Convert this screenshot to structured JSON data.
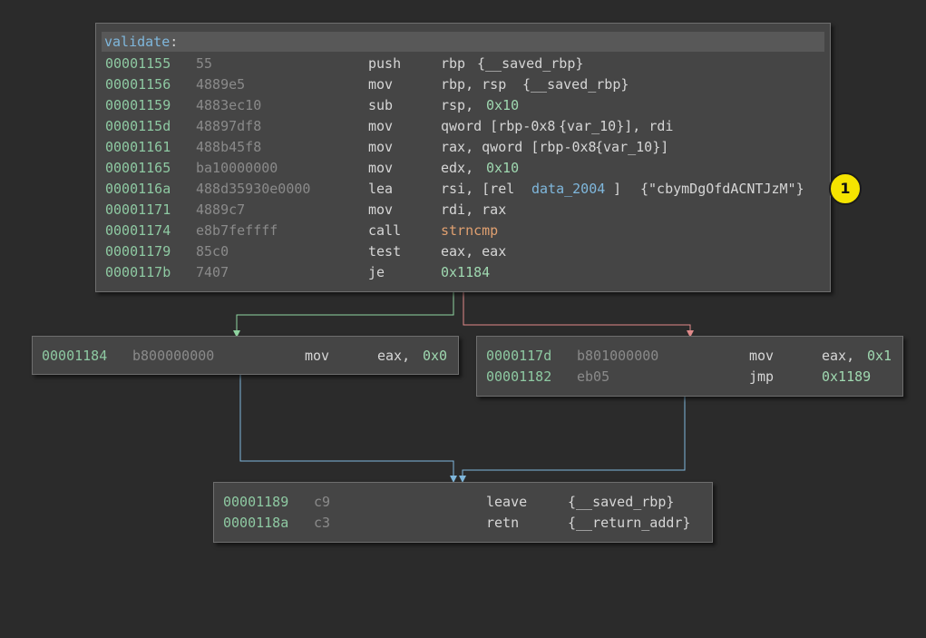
{
  "colors": {
    "background": "#2b2b2b",
    "block_bg": "#454545",
    "address": "#8ec9a2",
    "bytes": "#8a8a8a",
    "symbol": "#7fb7dc",
    "call_target": "#e0a070",
    "edge_true": "#8fd4a0",
    "edge_false": "#e08a8a",
    "edge_unconditional": "#7fb7dc",
    "badge": "#f5e400"
  },
  "entry_block": {
    "function_name": "validate",
    "colon": ":",
    "rows": [
      {
        "addr": "00001155",
        "bytes": "55",
        "mnem": "push",
        "op1": "rbp",
        "op2": "{__saved_rbp}"
      },
      {
        "addr": "00001156",
        "bytes": "4889e5",
        "mnem": "mov",
        "op1": "rbp, rsp",
        "op2": "{__saved_rbp}"
      },
      {
        "addr": "00001159",
        "bytes": "4883ec10",
        "mnem": "sub",
        "op1": "rsp,",
        "op2": "0x10"
      },
      {
        "addr": "0000115d",
        "bytes": "48897df8",
        "mnem": "mov",
        "op1": "qword [rbp-0x8",
        "op2": "{var_10}], rdi"
      },
      {
        "addr": "00001161",
        "bytes": "488b45f8",
        "mnem": "mov",
        "op1": "rax, qword [rbp-0x8",
        "op2": "{var_10}]"
      },
      {
        "addr": "00001165",
        "bytes": "ba10000000",
        "mnem": "mov",
        "op1": "edx,",
        "op2": "0x10"
      },
      {
        "addr": "0000116a",
        "bytes": "488d35930e0000",
        "mnem": "lea",
        "op1": "rsi, [rel",
        "op2": "data_2004",
        "op3": "]",
        "op4": "{\"cbymDgOfdACNTJzM\"}"
      },
      {
        "addr": "00001171",
        "bytes": "4889c7",
        "mnem": "mov",
        "op1": "rdi, rax"
      },
      {
        "addr": "00001174",
        "bytes": "e8b7feffff",
        "mnem": "call",
        "op1": "strncmp"
      },
      {
        "addr": "00001179",
        "bytes": "85c0",
        "mnem": "test",
        "op1": "eax, eax"
      },
      {
        "addr": "0000117b",
        "bytes": "7407",
        "mnem": "je",
        "op1": "0x1184"
      }
    ]
  },
  "true_block": {
    "rows": [
      {
        "addr": "00001184",
        "bytes": "b800000000",
        "mnem": "mov",
        "op1": "eax,",
        "op2": "0x0"
      }
    ]
  },
  "false_block": {
    "rows": [
      {
        "addr": "0000117d",
        "bytes": "b801000000",
        "mnem": "mov",
        "op1": "eax,",
        "op2": "0x1"
      },
      {
        "addr": "00001182",
        "bytes": "eb05",
        "mnem": "jmp",
        "op1": "0x1189"
      }
    ]
  },
  "exit_block": {
    "rows": [
      {
        "addr": "00001189",
        "bytes": "c9",
        "mnem": "leave",
        "op1": "{__saved_rbp}"
      },
      {
        "addr": "0000118a",
        "bytes": "c3",
        "mnem": "retn",
        "op1": "{__return_addr}"
      }
    ]
  },
  "annotation_badge": "1"
}
